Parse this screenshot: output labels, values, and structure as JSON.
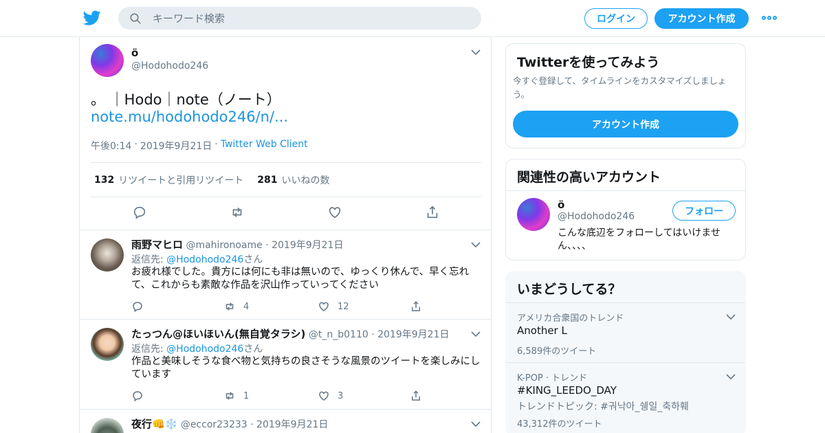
{
  "header": {
    "search_placeholder": "キーワード検索",
    "login_label": "ログイン",
    "signup_label": "アカウント作成",
    "brand_color": "#1da1f2"
  },
  "main_tweet": {
    "name": "ö",
    "handle": "@Hodohodo246",
    "text": "。 ｜Hodo｜note（ノート）",
    "link": "note.mu/hodohodo246/n/...",
    "time": "午後0:14",
    "date": "2019年9月21日",
    "source": "Twitter Web Client",
    "retweet_count": "132",
    "retweet_label": "リツイートと引用リツイート",
    "like_count": "281",
    "like_label": "いいねの数"
  },
  "replies": [
    {
      "name": "雨野マヒロ",
      "handle": "@mahironoame",
      "date": "2019年9月21日",
      "reply_prefix": "返信先:",
      "reply_to": "@Hodohodo246",
      "reply_suffix": "さん",
      "text": "お疲れ様でした。貴方には何にも非は無いので、ゆっくり休んで、早く忘れて、これからも素敵な作品を沢山作っていってください",
      "retweets": "4",
      "likes": "12"
    },
    {
      "name": "たっつん@ほいほいん(無自覚タラシ)",
      "handle": "@t_n_b0110",
      "date": "2019年9月21日",
      "reply_prefix": "返信先:",
      "reply_to": "@Hodohodo246",
      "reply_suffix": "さん",
      "text": "作品と美味しそうな食べ物と気持ちの良さそうな風景のツイートを楽しみにしています",
      "retweets": "1",
      "likes": "3"
    },
    {
      "name": "夜行👊❄️",
      "handle": "@eccor23233",
      "date": "2019年9月21日"
    }
  ],
  "signup_card": {
    "title": "Twitterを使ってみよう",
    "description": "今すぐ登録して、タイムラインをカスタマイズしましょう。",
    "button_label": "アカウント作成"
  },
  "related_card": {
    "title": "関連性の高いアカウント",
    "name": "ö",
    "handle": "@Hodohodo246",
    "follow_label": "フォロー",
    "bio": "こんな底辺をフォローしてはいけません、、、、"
  },
  "trends_card": {
    "title": "いまどうしてる？",
    "items": [
      {
        "meta": "アメリカ合衆国のトレンド",
        "name": "Another L",
        "count": "6,589件のツイート"
      },
      {
        "meta": "K-POP · トレンド",
        "name": "#KING_LEEDO_DAY",
        "topic": "トレンドトピック: #궈낙아_쉥일_축하훼",
        "count": "43,312件のツイート"
      }
    ]
  }
}
